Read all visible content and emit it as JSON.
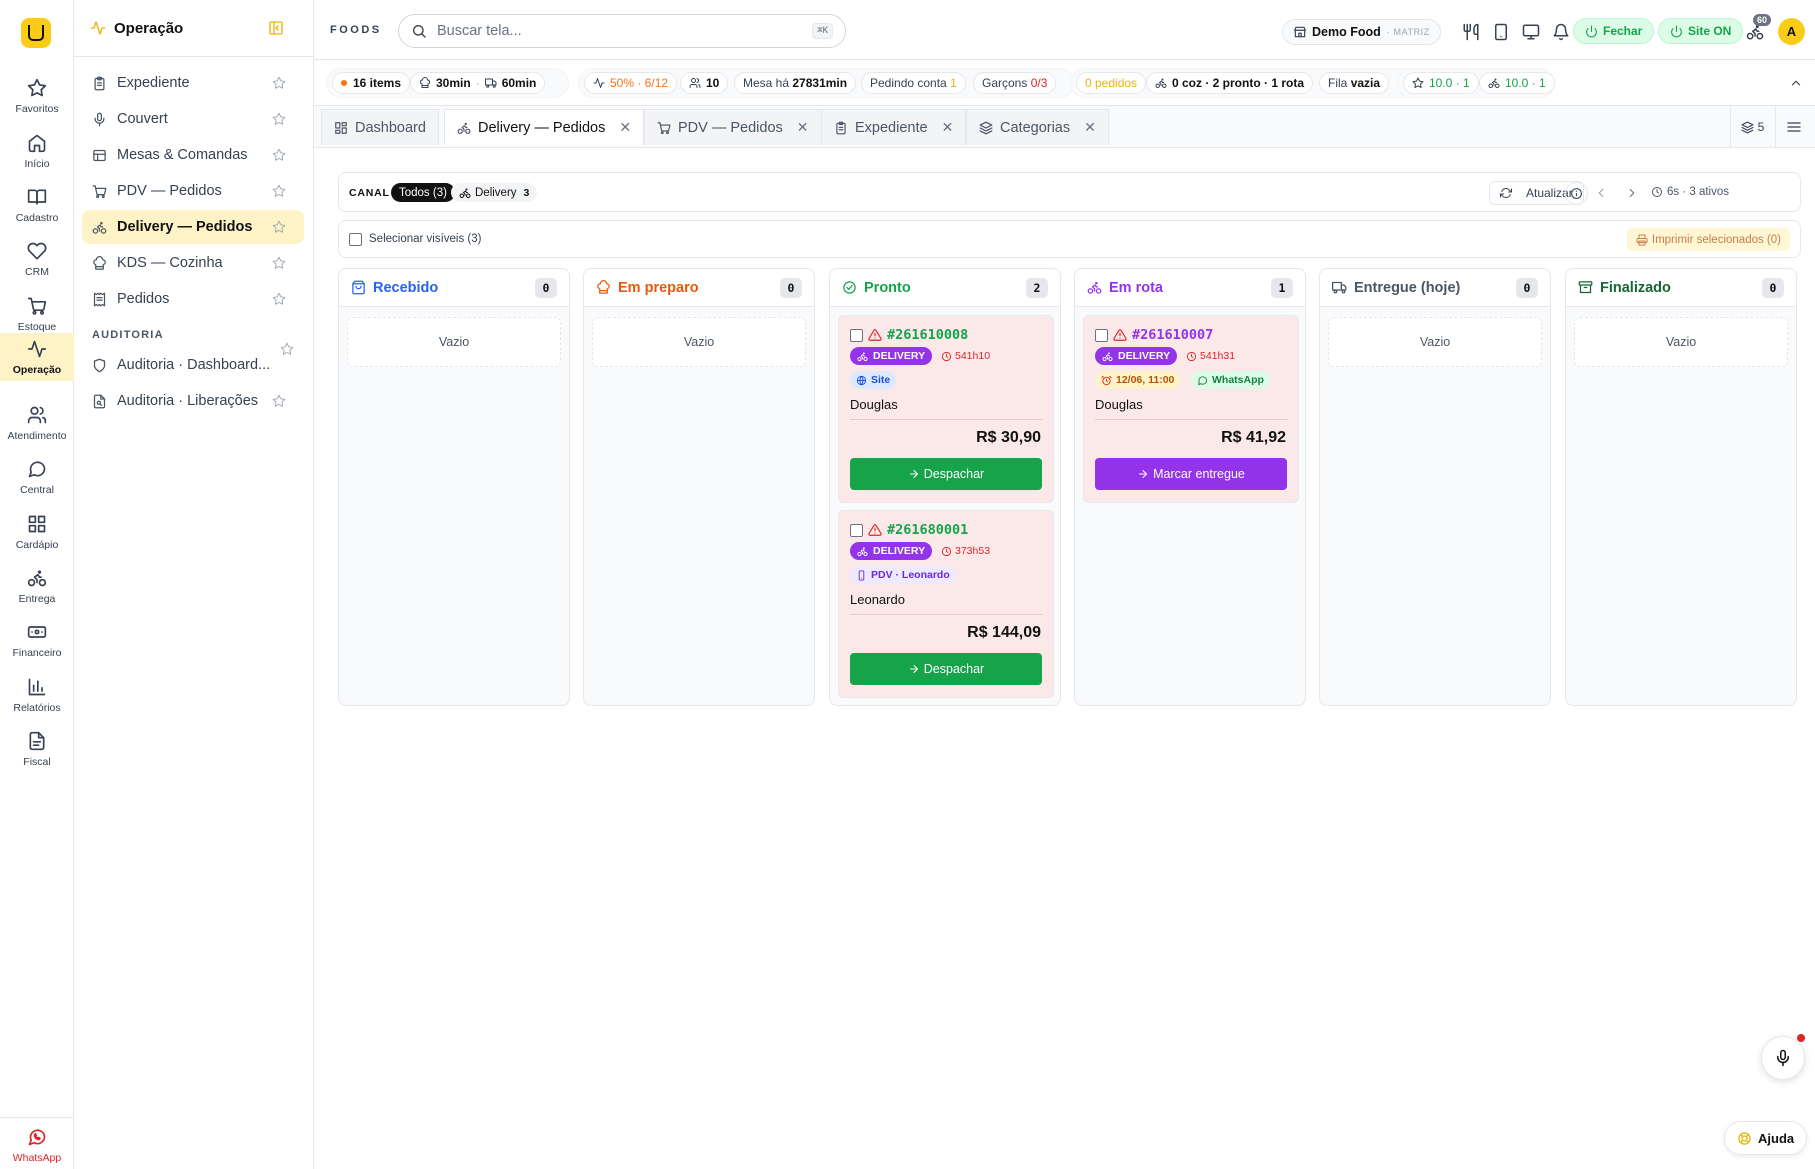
{
  "rail": {
    "items": [
      {
        "label": "Favoritos",
        "icon": "star-icon"
      },
      {
        "label": "Início",
        "icon": "home-icon"
      },
      {
        "label": "Cadastro",
        "icon": "book-icon"
      },
      {
        "label": "CRM",
        "icon": "heart-icon"
      },
      {
        "label": "Estoque",
        "icon": "cart-icon"
      },
      {
        "label": "Operação",
        "icon": "activity-icon",
        "active": true
      },
      {
        "label": "Atendimento",
        "icon": "users-icon"
      },
      {
        "label": "Central",
        "icon": "chat-icon"
      },
      {
        "label": "Cardápio",
        "icon": "grid-icon"
      },
      {
        "label": "Entrega",
        "icon": "bike-icon"
      },
      {
        "label": "Financeiro",
        "icon": "cash-icon"
      },
      {
        "label": "Relatórios",
        "icon": "chart-icon"
      },
      {
        "label": "Fiscal",
        "icon": "file-icon"
      }
    ],
    "whatsapp_label": "WhatsApp"
  },
  "sidebar": {
    "title": "Operação",
    "items": [
      {
        "label": "Expediente"
      },
      {
        "label": "Couvert"
      },
      {
        "label": "Mesas & Comandas"
      },
      {
        "label": "PDV — Pedidos"
      },
      {
        "label": "Delivery — Pedidos",
        "active": true
      },
      {
        "label": "KDS — Cozinha"
      },
      {
        "label": "Pedidos"
      }
    ],
    "section_label": "AUDITORIA",
    "audit_items": [
      {
        "label": "Auditoria · Dashboard..."
      },
      {
        "label": "Auditoria · Liberações"
      }
    ]
  },
  "topbar": {
    "brand": "FOODS",
    "search_placeholder": "Buscar tela...",
    "search_shortcut": "⌘K",
    "store_name": "Demo Food",
    "store_tag": "· MATRIZ",
    "close_label": "Fechar",
    "site_label": "Site ON",
    "notif_count": "60",
    "avatar_initial": "A"
  },
  "status": {
    "items_count": "16 items",
    "prep_time": "30min",
    "delivery_time": "60min",
    "occupancy": "50% · 6/12",
    "people": "10",
    "mesa_label": "Mesa há",
    "mesa_value": "27831min",
    "pedindo_label": "Pedindo conta",
    "pedindo_value": "1",
    "garcons_label": "Garçons",
    "garcons_value": "0/3",
    "orders": "0 pedidos",
    "kitchen": "0 coz · 2 pronto · 1 rota",
    "fila_label": "Fila",
    "fila_value": "vazia",
    "rating_1": "10.0 · 1",
    "rating_2": "10.0 · 1"
  },
  "tabs": [
    {
      "label": "Dashboard",
      "closable": false
    },
    {
      "label": "Delivery — Pedidos",
      "closable": true,
      "active": true
    },
    {
      "label": "PDV — Pedidos",
      "closable": true
    },
    {
      "label": "Expediente",
      "closable": true
    },
    {
      "label": "Categorias",
      "closable": true
    }
  ],
  "tabs_count": "5",
  "filter": {
    "label": "CANAL",
    "all_chip": "Todos (3)",
    "delivery_chip": "Delivery",
    "delivery_count": "3",
    "meta": "6s · 3 ativos",
    "refresh_label": "Atualizar"
  },
  "selection": {
    "label": "Selecionar visíveis (3)",
    "print_label": "Imprimir selecionados (0)"
  },
  "columns": [
    {
      "title": "Recebido",
      "count": "0",
      "color": "#2563eb",
      "empty_label": "Vazio"
    },
    {
      "title": "Em preparo",
      "count": "0",
      "color": "#ea580c",
      "empty_label": "Vazio"
    },
    {
      "title": "Pronto",
      "count": "2",
      "color": "#16a34a"
    },
    {
      "title": "Em rota",
      "count": "1",
      "color": "#9333ea"
    },
    {
      "title": "Entregue (hoje)",
      "count": "0",
      "color": "#4b5563",
      "empty_label": "Vazio"
    },
    {
      "title": "Finalizado",
      "count": "0",
      "color": "#166534",
      "empty_label": "Vazio"
    }
  ],
  "cards": {
    "c1": {
      "number": "#261610008",
      "type": "DELIVERY",
      "timer": "541h10",
      "source": "Site",
      "customer": "Douglas",
      "total": "R$ 30,90",
      "action": "Despachar"
    },
    "c2": {
      "number": "#261680001",
      "type": "DELIVERY",
      "timer": "373h53",
      "source": "PDV · Leonardo",
      "customer": "Leonardo",
      "total": "R$ 144,09",
      "action": "Despachar"
    },
    "c3": {
      "number": "#261610007",
      "type": "DELIVERY",
      "timer": "541h31",
      "schedule": "12/06, 11:00",
      "source": "WhatsApp",
      "customer": "Douglas",
      "total": "R$ 41,92",
      "action": "Marcar entregue"
    }
  },
  "help_label": "Ajuda"
}
